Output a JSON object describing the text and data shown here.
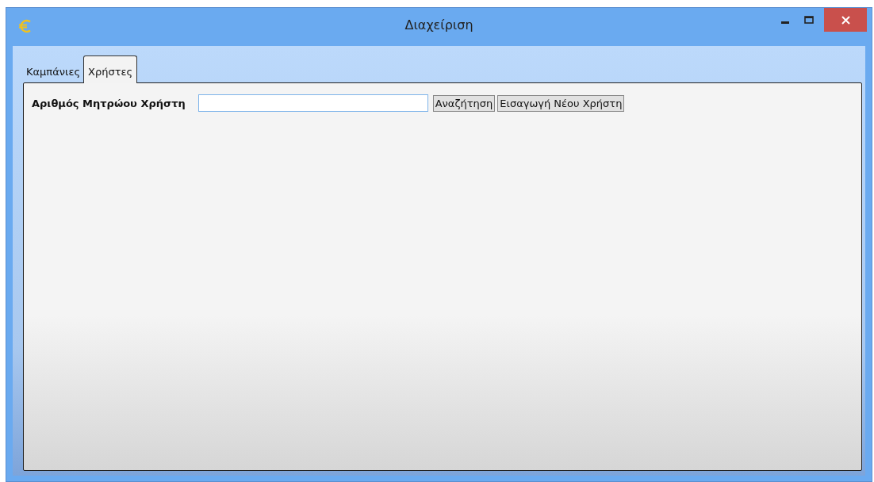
{
  "window": {
    "title": "Διαχείριση"
  },
  "tabs": [
    {
      "label": "Καμπάνιες",
      "selected": false
    },
    {
      "label": "Χρήστες",
      "selected": true
    }
  ],
  "form": {
    "label": "Αριθμός Μητρώου Χρήστη",
    "buttons": [
      "Αναζήτηση",
      "Εισαγωγή Νέου Χρήστη"
    ]
  }
}
